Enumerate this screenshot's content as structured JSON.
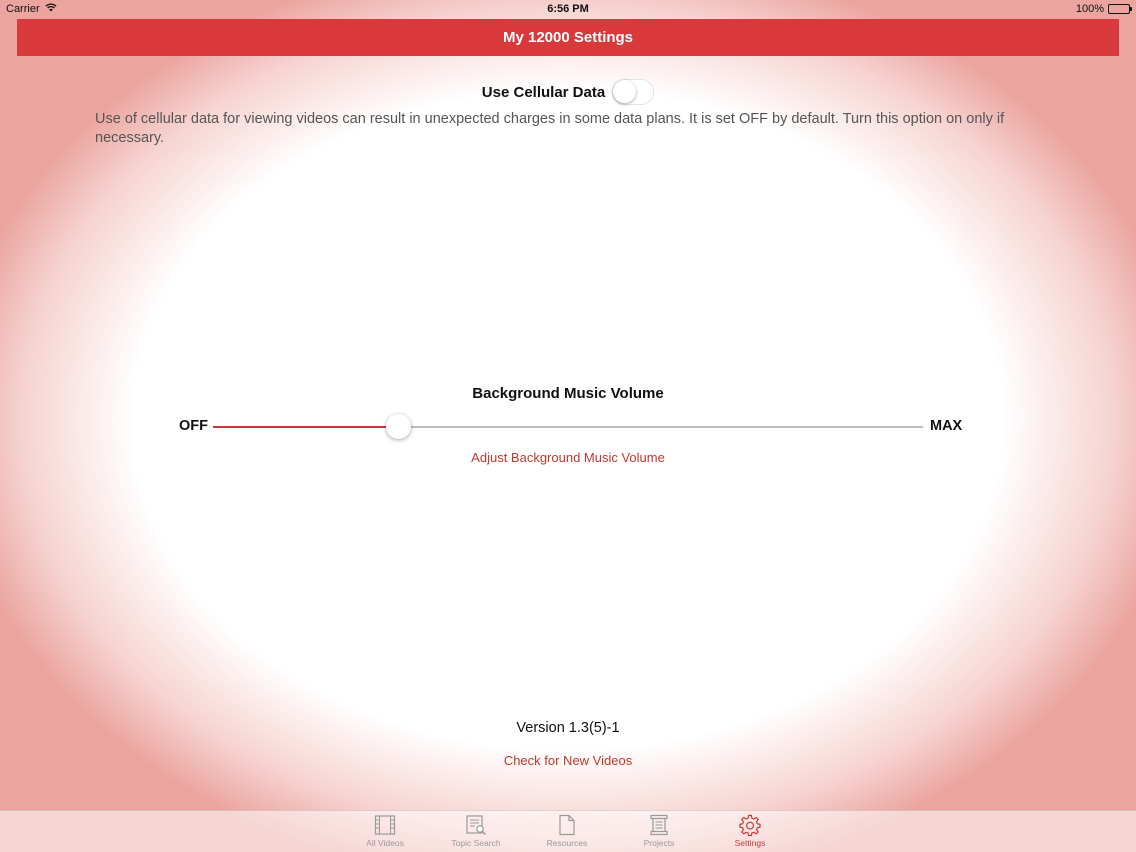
{
  "status_bar": {
    "carrier": "Carrier",
    "time": "6:56 PM",
    "battery": "100%"
  },
  "nav": {
    "title": "My 12000 Settings"
  },
  "cellular": {
    "label": "Use Cellular Data",
    "enabled": false,
    "description": "Use of cellular data for viewing videos can result in unexpected charges in some data plans. It is set OFF by default. Turn this option on only if necessary."
  },
  "volume": {
    "title": "Background Music Volume",
    "min_label": "OFF",
    "max_label": "MAX",
    "level": 0.26,
    "adjust_label": "Adjust Background Music Volume"
  },
  "footer": {
    "version": "Version 1.3(5)-1",
    "check_label": "Check for New Videos"
  },
  "tabs": [
    {
      "label": "All Videos",
      "icon": "film-icon",
      "active": false
    },
    {
      "label": "Topic Search",
      "icon": "search-document-icon",
      "active": false
    },
    {
      "label": "Resources",
      "icon": "document-icon",
      "active": false
    },
    {
      "label": "Projects",
      "icon": "scroll-icon",
      "active": false
    },
    {
      "label": "Settings",
      "icon": "gear-icon",
      "active": true
    }
  ],
  "colors": {
    "accent": "#d9393a",
    "link": "#c0392b"
  }
}
